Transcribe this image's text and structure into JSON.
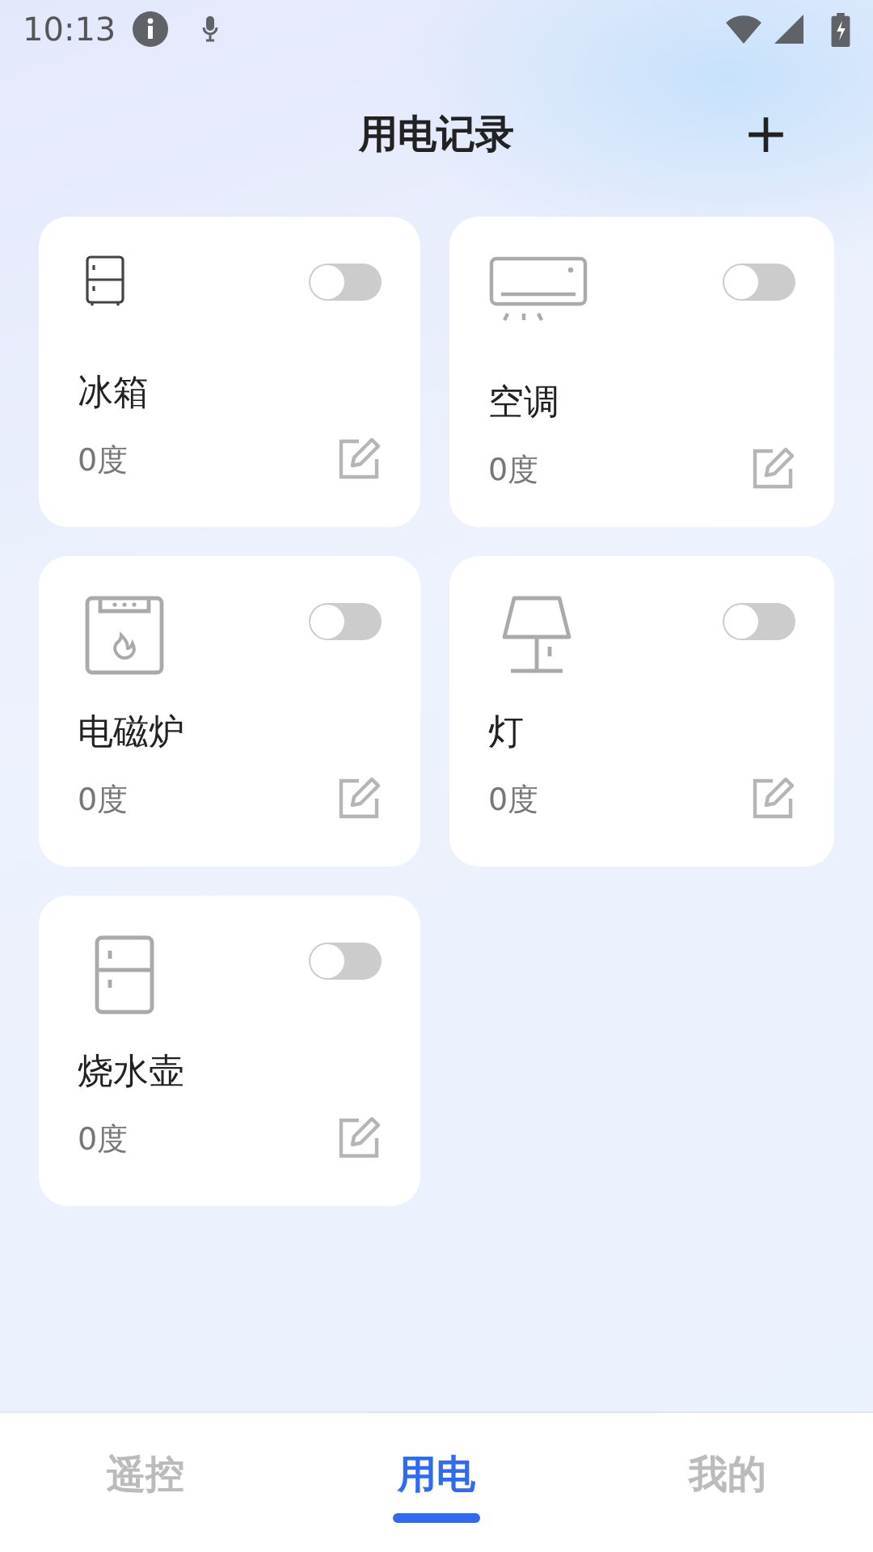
{
  "status_bar": {
    "time": "10:13"
  },
  "header": {
    "title": "用电记录",
    "add_icon": "+"
  },
  "devices": [
    {
      "kind": "fridge",
      "name": "冰箱",
      "usage": "0度",
      "on": false
    },
    {
      "kind": "aircon",
      "name": "空调",
      "usage": "0度",
      "on": false
    },
    {
      "kind": "cooker",
      "name": "电磁炉",
      "usage": "0度",
      "on": false
    },
    {
      "kind": "lamp",
      "name": "灯",
      "usage": "0度",
      "on": false
    },
    {
      "kind": "kettle",
      "name": "烧水壶",
      "usage": "0度",
      "on": false
    }
  ],
  "tabs": [
    {
      "label": "遥控",
      "selected": false
    },
    {
      "label": "用电",
      "selected": true
    },
    {
      "label": "我的",
      "selected": false
    }
  ]
}
